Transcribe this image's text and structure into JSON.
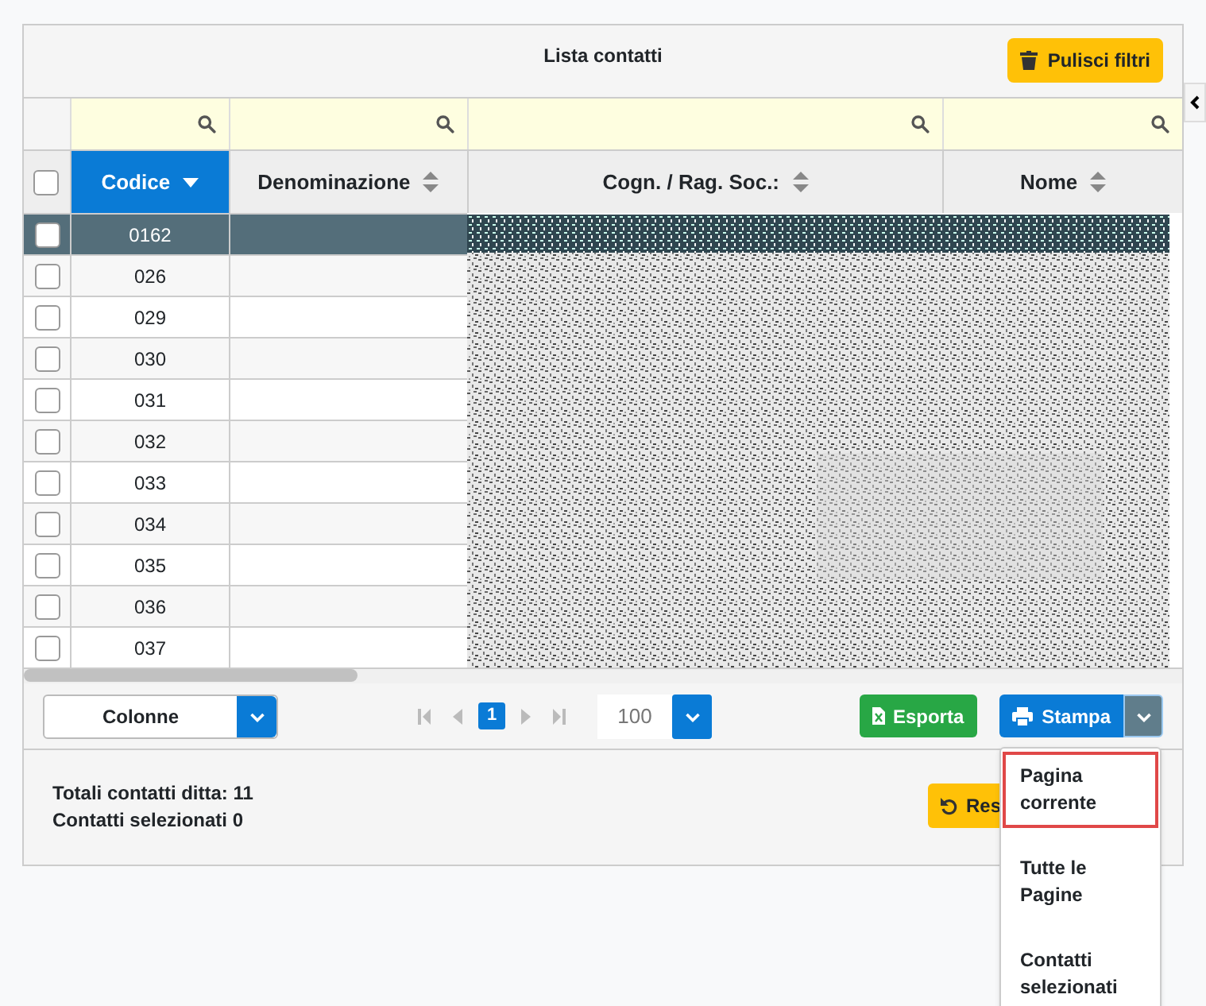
{
  "title": "Lista contatti",
  "clear_filters_button": "Pulisci filtri",
  "select_all_checked": false,
  "columns": [
    {
      "label": "Codice",
      "selected": true
    },
    {
      "label": "Denominazione",
      "selected": false
    },
    {
      "label": "Cogn. / Rag. Soc.:",
      "selected": false
    },
    {
      "label": "Nome",
      "selected": false
    }
  ],
  "rows": [
    {
      "codice": "0162",
      "selected": true,
      "checked": false
    },
    {
      "codice": "026",
      "selected": false,
      "checked": false
    },
    {
      "codice": "029",
      "selected": false,
      "checked": false
    },
    {
      "codice": "030",
      "selected": false,
      "checked": false
    },
    {
      "codice": "031",
      "selected": false,
      "checked": false
    },
    {
      "codice": "032",
      "selected": false,
      "checked": false
    },
    {
      "codice": "033",
      "selected": false,
      "checked": false
    },
    {
      "codice": "034",
      "selected": false,
      "checked": false
    },
    {
      "codice": "035",
      "selected": false,
      "checked": false
    },
    {
      "codice": "036",
      "selected": false,
      "checked": false
    },
    {
      "codice": "037",
      "selected": false,
      "checked": false
    }
  ],
  "columns_button": "Colonne",
  "pager": {
    "current_page": "1",
    "page_size": "100"
  },
  "export_button": "Esporta",
  "print_button": "Stampa",
  "print_menu": [
    {
      "label": "Pagina corrente",
      "selected": true
    },
    {
      "label": "Tutte le Pagine",
      "selected": false
    },
    {
      "label": "Contatti selezionati",
      "selected": false
    }
  ],
  "totals": [
    "Totali contatti ditta: 11",
    "Contatti selezionati 0"
  ],
  "reset_button": "Res"
}
